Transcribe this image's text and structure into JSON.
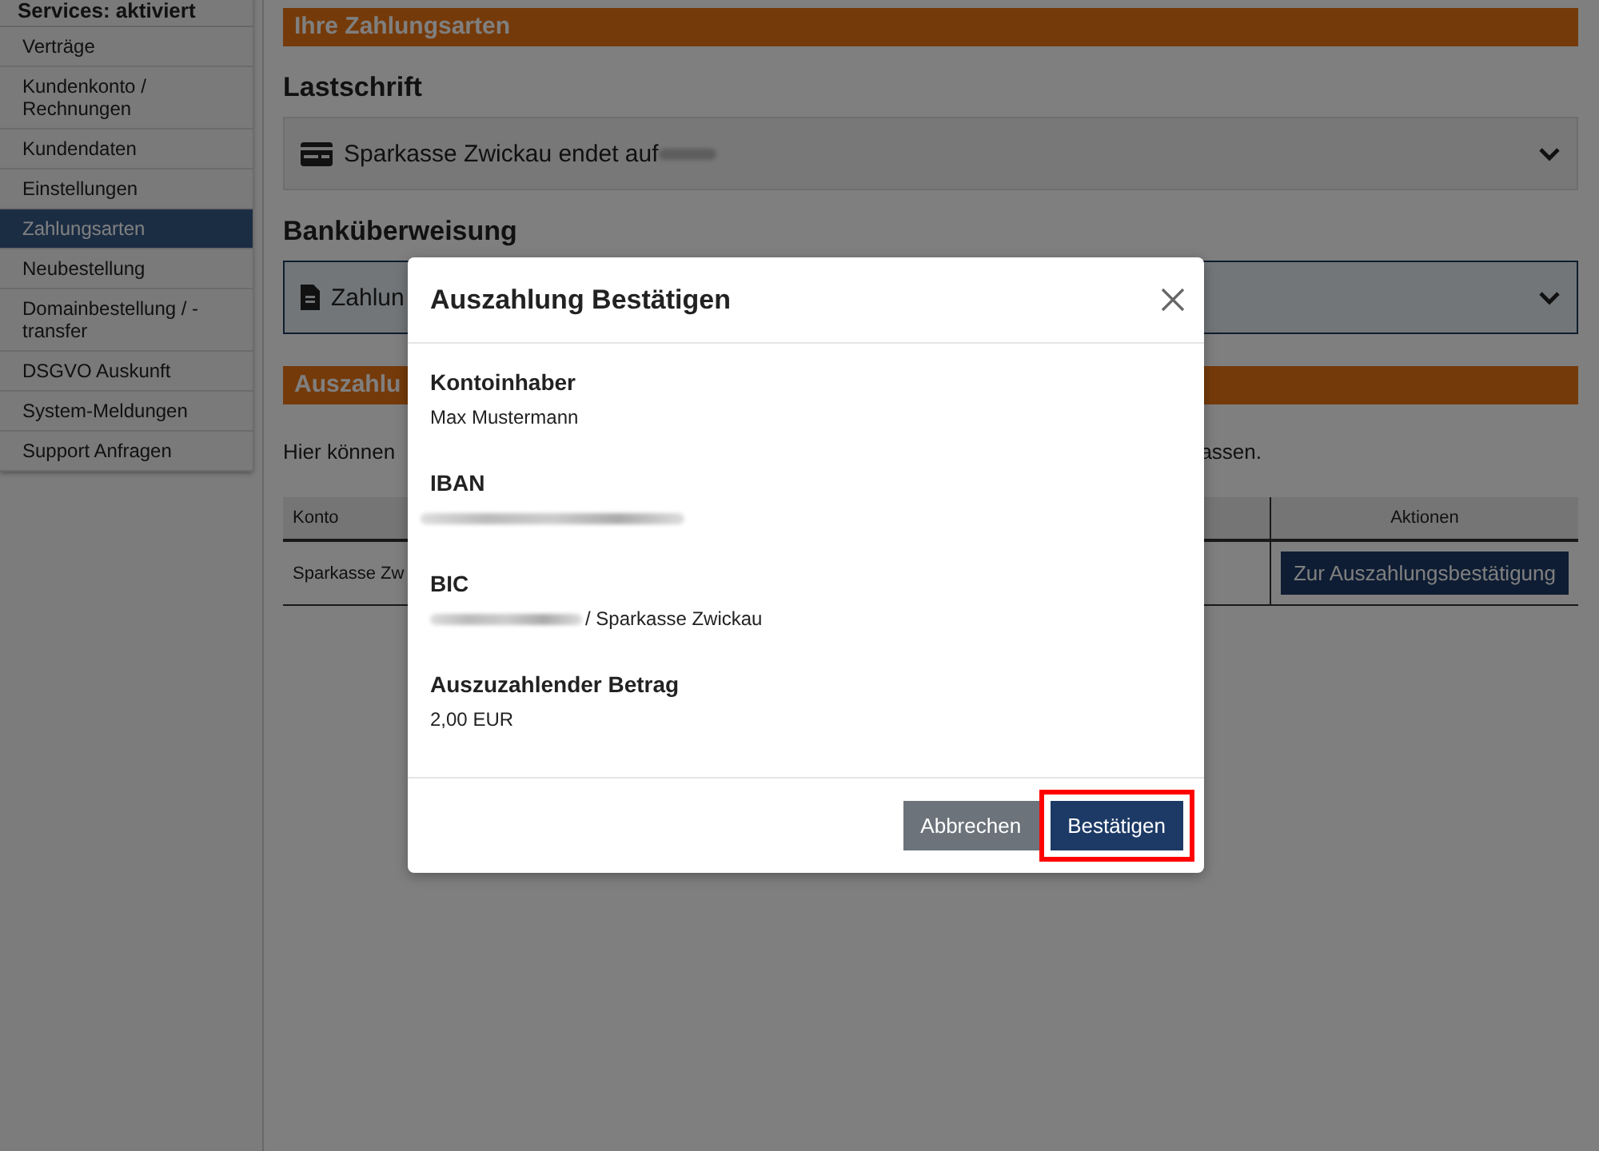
{
  "sidebar": {
    "header": "Services: aktiviert",
    "items": [
      {
        "label": "Verträge",
        "selected": false
      },
      {
        "label": "Kundenkonto / Rechnungen",
        "selected": false
      },
      {
        "label": "Kundendaten",
        "selected": false
      },
      {
        "label": "Einstellungen",
        "selected": false
      },
      {
        "label": "Zahlungsarten",
        "selected": true
      },
      {
        "label": "Neubestellung",
        "selected": false
      },
      {
        "label": "Domainbestellung / -transfer",
        "selected": false
      },
      {
        "label": "DSGVO Auskunft",
        "selected": false
      },
      {
        "label": "System-Meldungen",
        "selected": false
      },
      {
        "label": "Support Anfragen",
        "selected": false
      }
    ]
  },
  "payment_methods": {
    "header": "Ihre Zahlungsarten",
    "sections": [
      {
        "title": "Lastschrift",
        "kind": "card",
        "text": "Sparkasse Zwickau endet auf",
        "redacted": true,
        "active": false
      },
      {
        "title": "Banküberweisung",
        "kind": "document",
        "text": "Zahlun",
        "redacted": false,
        "active": true
      }
    ]
  },
  "payout": {
    "header": "Auszahlu",
    "text_start": "Hier können",
    "text_end": "assen.",
    "table": {
      "columns": [
        "Konto",
        "Aktionen"
      ],
      "rows": [
        {
          "konto": "Sparkasse Zw",
          "action": "Zur Auszahlungsbestätigung"
        }
      ]
    }
  },
  "modal": {
    "title": "Auszahlung Bestätigen",
    "fields": [
      {
        "label": "Kontoinhaber",
        "value": "Max Mustermann",
        "redacted": false
      },
      {
        "label": "IBAN",
        "redacted": true
      },
      {
        "label": "BIC",
        "value": "/ Sparkasse Zwickau",
        "redacted": true
      },
      {
        "label": "Auszuzahlender Betrag",
        "value": "2,00 EUR",
        "redacted": false
      }
    ],
    "buttons": [
      {
        "label": "Abbrechen",
        "kind": "secondary",
        "highlighted": false
      },
      {
        "label": "Bestätigen",
        "kind": "primary",
        "highlighted": true
      }
    ]
  }
}
